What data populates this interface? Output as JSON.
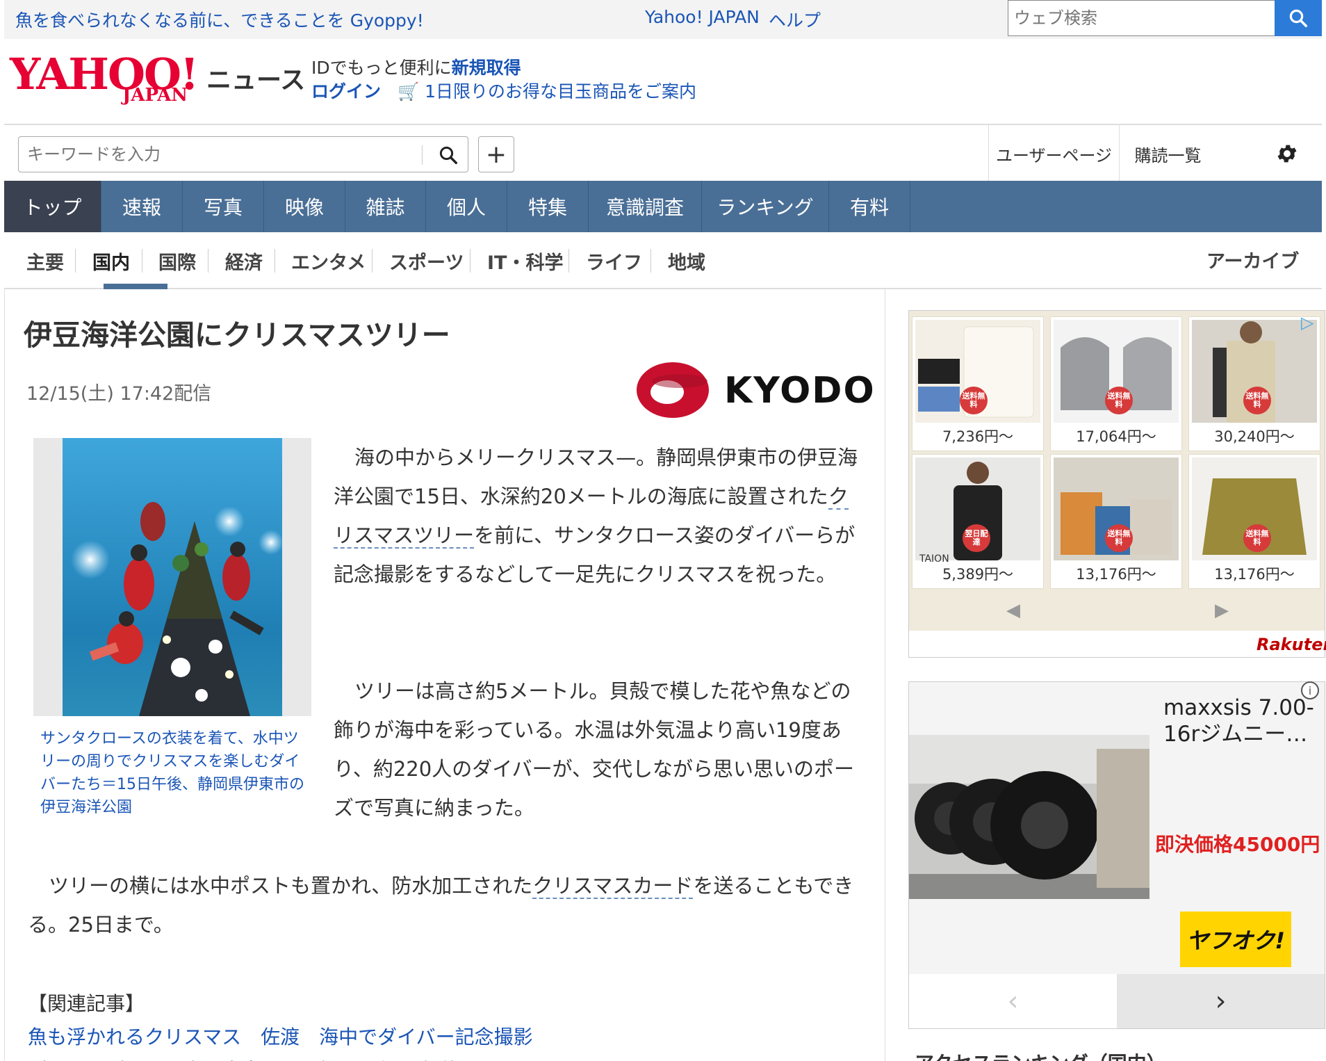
{
  "promo": {
    "text": "魚を食べられなくなる前に、できることを Gyoppy!"
  },
  "top_links": {
    "yahoo_japan": "Yahoo! JAPAN",
    "help": "ヘルプ"
  },
  "web_search": {
    "placeholder": "ウェブ検索"
  },
  "logo": {
    "yahoo": "YAHOO!",
    "japan": "JAPAN",
    "news": "ニュース"
  },
  "account": {
    "id_text": "IDでもっと便利に",
    "signup": "新規取得",
    "login": "ログイン",
    "deal": "1日限りのお得な目玉商品をご案内"
  },
  "keyword_search": {
    "placeholder": "キーワードを入力"
  },
  "right_menu": {
    "user_page": "ユーザーページ",
    "subscriptions": "購読一覧"
  },
  "main_nav": [
    "トップ",
    "速報",
    "写真",
    "映像",
    "雑誌",
    "個人",
    "特集",
    "意識調査",
    "ランキング",
    "有料"
  ],
  "sub_nav": [
    "主要",
    "国内",
    "国際",
    "経済",
    "エンタメ",
    "スポーツ",
    "IT・科学",
    "ライフ",
    "地域"
  ],
  "archive": "アーカイブ",
  "article": {
    "title": "伊豆海洋公園にクリスマスツリー",
    "date": "12/15(土) 17:42配信",
    "source": "KYODO",
    "caption": "サンタクロースの衣装を着て、水中ツリーの周りでクリスマスを楽しむダイバーたち＝15日午後、静岡県伊東市の伊豆海洋公園",
    "p1_a": "海の中からメリークリスマス—。静岡県伊東市の伊豆海洋公園で15日、水深約20メートルの海底に設置された",
    "p1_link": "クリスマスツリー",
    "p1_b": "を前に、サンタクロース姿のダイバーらが記念撮影をするなどして一足先にクリスマスを祝った。",
    "p2": "ツリーは高さ約5メートル。貝殻で模した花や魚などの飾りが海中を彩っている。水温は外気温より高い19度あり、約220人のダイバーが、交代しながら思い思いのポーズで写真に納まった。",
    "p3_a": "ツリーの横には水中ポストも置かれ、防水加工された",
    "p3_link": "クリスマスカード",
    "p3_b": "を送ることもできる。25日まで。",
    "related_label": "【関連記事】",
    "related_1": "魚も浮かれるクリスマス　佐渡　海中でダイバー記念撮影",
    "related_2": "ダイバーがサンタ姿で水中ツリー設置　伊豆海洋公園"
  },
  "rakuten_ad": {
    "prices": [
      "7,236円〜",
      "17,064円〜",
      "30,240円〜",
      "5,389円〜",
      "13,176円〜",
      "13,176円〜"
    ],
    "badge": "送料無料",
    "badge_alt": "翌日配達",
    "brand_label": "TAION",
    "logo": "Rakuten"
  },
  "auction_ad": {
    "title": "maxxsis 7.00-16rジムニー…",
    "price": "即決価格45000円",
    "logo": "ヤフオク!"
  },
  "access_ranking": "アクセスランキング（国内）"
}
